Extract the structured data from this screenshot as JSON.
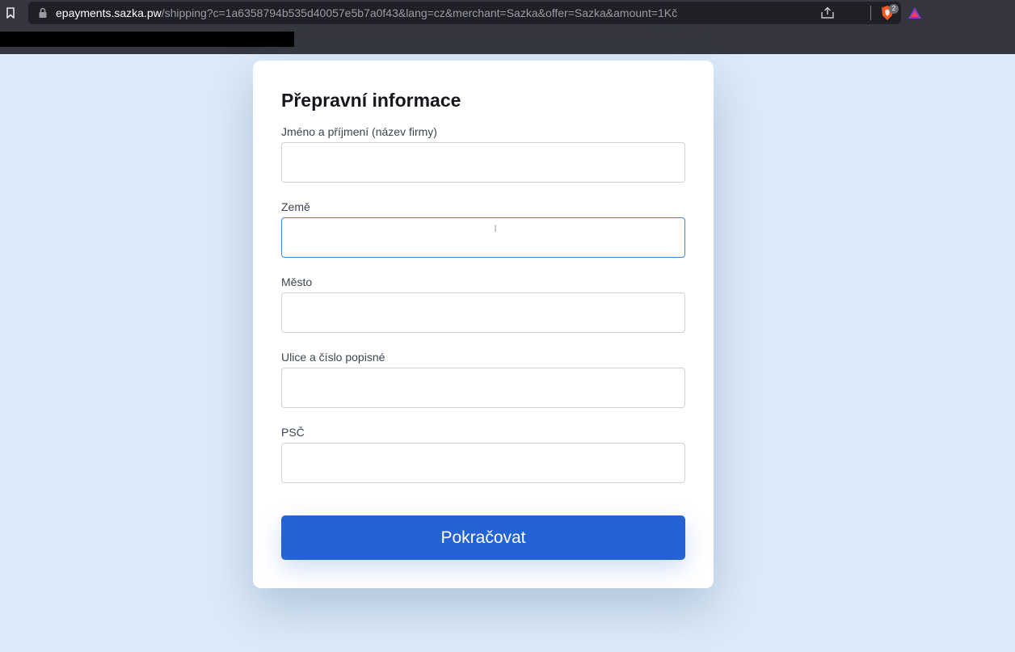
{
  "browser": {
    "url_host": "epayments.sazka.pw",
    "url_path": "/shipping?c=1a6358794b535d40057e5b7a0f43&lang=cz&merchant=Sazka&offer=Sazka&amount=1Kč",
    "shield_count": "2",
    "icons": [
      "bookmark-icon",
      "lock-icon",
      "share-icon",
      "brave-shield-icon",
      "brave-rewards-icon"
    ]
  },
  "form": {
    "title": "Přepravní informace",
    "fields": [
      {
        "label": "Jméno a příjmení (název firmy)",
        "value": ""
      },
      {
        "label": "Země",
        "value": ""
      },
      {
        "label": "Město",
        "value": ""
      },
      {
        "label": "Ulice a číslo popisné",
        "value": ""
      },
      {
        "label": "PSČ",
        "value": ""
      }
    ],
    "submit_label": "Pokračovat"
  },
  "colors": {
    "page_background": "#dcebfa",
    "chrome_background": "#35363f",
    "primary_button": "#2563d4",
    "focus_border": "#3f87d6"
  }
}
